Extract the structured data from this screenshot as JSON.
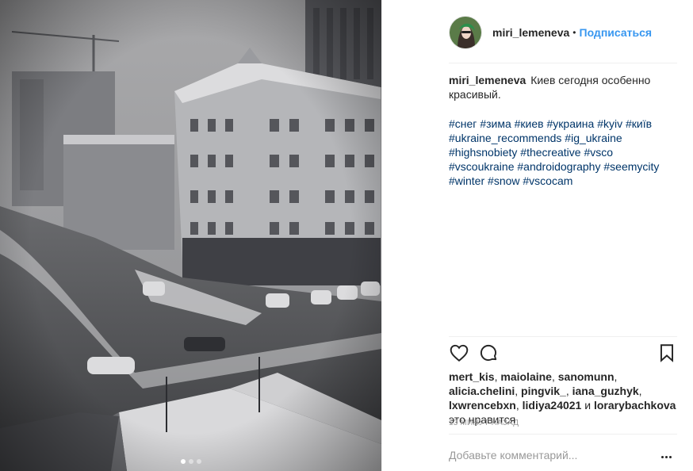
{
  "photo": {
    "alt_icon": "city-snow-photo",
    "carousel": {
      "total": 3,
      "active": 0
    }
  },
  "header": {
    "username": "miri_lemeneva",
    "bullet": "•",
    "follow_label": "Подписаться"
  },
  "caption": {
    "author": "miri_lemeneva",
    "text": "Киев сегодня особенно красивый.",
    "hashtags": [
      "#снег",
      "#зима",
      "#киев",
      "#украина",
      "#kyiv",
      "#київ",
      "#ukraine_recommends",
      "#ig_ukraine",
      "#highsnobiety",
      "#thecreative",
      "#vsco",
      "#vscoukraine",
      "#androidography",
      "#seemycity",
      "#winter",
      "#snow",
      "#vscocam"
    ]
  },
  "actions": {
    "like_icon": "heart-icon",
    "comment_icon": "comment-bubble-icon",
    "save_icon": "bookmark-icon"
  },
  "likes": {
    "users": [
      "mert_kis",
      "maiolaine",
      "sanomunn",
      "alicia.chelini",
      "pingvik_",
      "iana_guzhyk",
      "lxwrencebxn",
      "lidiya24021"
    ],
    "and_word": "и",
    "last_user": "lorarybachkova",
    "suffix": "это нравится"
  },
  "timestamp": "13 МИНУТ НАЗАД",
  "comment": {
    "placeholder": "Добавьте комментарий...",
    "more_icon": "more-options-icon"
  },
  "colors": {
    "link": "#3897f0",
    "hashtag": "#003569",
    "muted": "#999999",
    "text": "#262626",
    "divider": "#efefef"
  }
}
